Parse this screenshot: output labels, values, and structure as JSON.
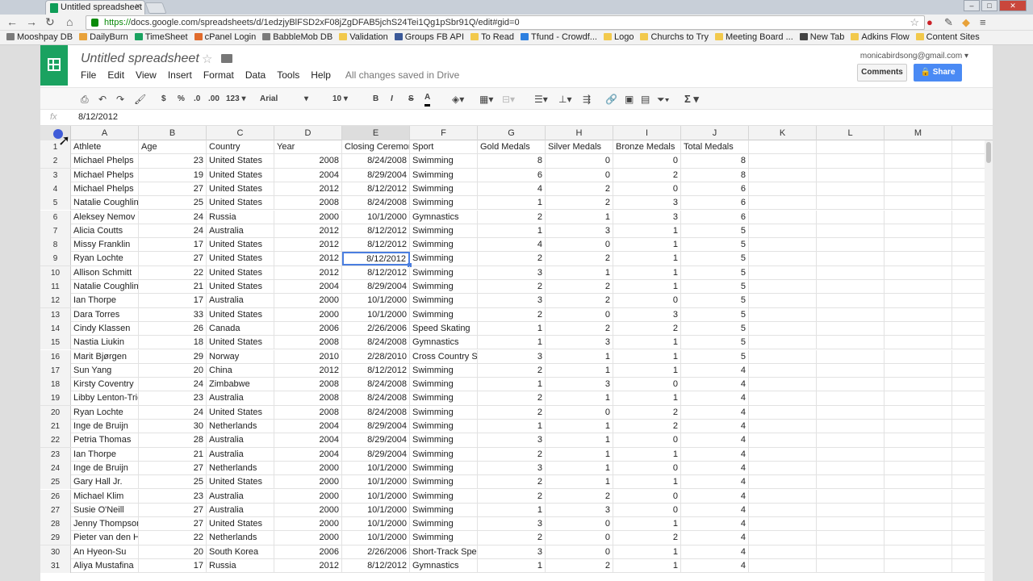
{
  "browser": {
    "tab_title": "Untitled spreadsheet",
    "tab_close": "×",
    "url_scheme": "https://",
    "url_rest": "docs.google.com/spreadsheets/d/1edzjyBlFSD2xF08jZgDFAB5jchS24Tei1Qg1pSbr91Q/edit#gid=0",
    "bookmarks": [
      {
        "label": "Mooshpay DB",
        "color": "#7b7b7b"
      },
      {
        "label": "DailyBurn",
        "color": "#e8a23a"
      },
      {
        "label": "TimeSheet",
        "color": "#1aa260"
      },
      {
        "label": "cPanel Login",
        "color": "#e06b2c"
      },
      {
        "label": "BabbleMob DB",
        "color": "#7b7b7b"
      },
      {
        "label": "Validation",
        "color": "#f2c94c"
      },
      {
        "label": "Groups FB API",
        "color": "#3b5998"
      },
      {
        "label": "To Read",
        "color": "#f2c94c"
      },
      {
        "label": "Tfund - Crowdf...",
        "color": "#2c7fe0"
      },
      {
        "label": "Logo",
        "color": "#f2c94c"
      },
      {
        "label": "Churchs to Try",
        "color": "#f2c94c"
      },
      {
        "label": "Meeting Board ...",
        "color": "#f2c94c"
      },
      {
        "label": "New Tab",
        "color": "#444444"
      },
      {
        "label": "Adkins Flow",
        "color": "#f2c94c"
      },
      {
        "label": "Content Sites",
        "color": "#f2c94c"
      }
    ]
  },
  "sheets": {
    "doc_title": "Untitled spreadsheet",
    "menus": [
      "File",
      "Edit",
      "View",
      "Insert",
      "Format",
      "Data",
      "Tools",
      "Help"
    ],
    "saved_status": "All changes saved in Drive",
    "user_email": "monicabirdsong@gmail.com",
    "comments_label": "Comments",
    "share_label": "Share",
    "toolbar": {
      "currency": "$",
      "percent": "%",
      "dec_decrease": ".0",
      "dec_increase": ".00",
      "more_formats": "123",
      "font": "Arial",
      "font_size": "10",
      "bold": "B",
      "italic": "I",
      "strike": "S",
      "text_color": "A",
      "sum": "Σ"
    },
    "formula_label": "fx",
    "formula_value": "8/12/2012"
  },
  "grid": {
    "columns": [
      "A",
      "B",
      "C",
      "D",
      "E",
      "F",
      "G",
      "H",
      "I",
      "J",
      "K",
      "L",
      "M"
    ],
    "selected_column": "E",
    "selected_row": 9,
    "header_row": [
      "Athlete",
      "Age",
      "Country",
      "Year",
      "Closing Ceremor",
      "Sport",
      "Gold Medals",
      "Silver Medals",
      "Bronze Medals",
      "Total Medals"
    ],
    "rows": [
      [
        "Michael Phelps",
        "23",
        "United States",
        "2008",
        "8/24/2008",
        "Swimming",
        "8",
        "0",
        "0",
        "8"
      ],
      [
        "Michael Phelps",
        "19",
        "United States",
        "2004",
        "8/29/2004",
        "Swimming",
        "6",
        "0",
        "2",
        "8"
      ],
      [
        "Michael Phelps",
        "27",
        "United States",
        "2012",
        "8/12/2012",
        "Swimming",
        "4",
        "2",
        "0",
        "6"
      ],
      [
        "Natalie Coughlin",
        "25",
        "United States",
        "2008",
        "8/24/2008",
        "Swimming",
        "1",
        "2",
        "3",
        "6"
      ],
      [
        "Aleksey Nemov",
        "24",
        "Russia",
        "2000",
        "10/1/2000",
        "Gymnastics",
        "2",
        "1",
        "3",
        "6"
      ],
      [
        "Alicia Coutts",
        "24",
        "Australia",
        "2012",
        "8/12/2012",
        "Swimming",
        "1",
        "3",
        "1",
        "5"
      ],
      [
        "Missy Franklin",
        "17",
        "United States",
        "2012",
        "8/12/2012",
        "Swimming",
        "4",
        "0",
        "1",
        "5"
      ],
      [
        "Ryan Lochte",
        "27",
        "United States",
        "2012",
        "8/12/2012",
        "Swimming",
        "2",
        "2",
        "1",
        "5"
      ],
      [
        "Allison Schmitt",
        "22",
        "United States",
        "2012",
        "8/12/2012",
        "Swimming",
        "3",
        "1",
        "1",
        "5"
      ],
      [
        "Natalie Coughlin",
        "21",
        "United States",
        "2004",
        "8/29/2004",
        "Swimming",
        "2",
        "2",
        "1",
        "5"
      ],
      [
        "Ian Thorpe",
        "17",
        "Australia",
        "2000",
        "10/1/2000",
        "Swimming",
        "3",
        "2",
        "0",
        "5"
      ],
      [
        "Dara Torres",
        "33",
        "United States",
        "2000",
        "10/1/2000",
        "Swimming",
        "2",
        "0",
        "3",
        "5"
      ],
      [
        "Cindy Klassen",
        "26",
        "Canada",
        "2006",
        "2/26/2006",
        "Speed Skating",
        "1",
        "2",
        "2",
        "5"
      ],
      [
        "Nastia Liukin",
        "18",
        "United States",
        "2008",
        "8/24/2008",
        "Gymnastics",
        "1",
        "3",
        "1",
        "5"
      ],
      [
        "Marit Bjørgen",
        "29",
        "Norway",
        "2010",
        "2/28/2010",
        "Cross Country S",
        "3",
        "1",
        "1",
        "5"
      ],
      [
        "Sun Yang",
        "20",
        "China",
        "2012",
        "8/12/2012",
        "Swimming",
        "2",
        "1",
        "1",
        "4"
      ],
      [
        "Kirsty Coventry",
        "24",
        "Zimbabwe",
        "2008",
        "8/24/2008",
        "Swimming",
        "1",
        "3",
        "0",
        "4"
      ],
      [
        "Libby Lenton-Tric",
        "23",
        "Australia",
        "2008",
        "8/24/2008",
        "Swimming",
        "2",
        "1",
        "1",
        "4"
      ],
      [
        "Ryan Lochte",
        "24",
        "United States",
        "2008",
        "8/24/2008",
        "Swimming",
        "2",
        "0",
        "2",
        "4"
      ],
      [
        "Inge de Bruijn",
        "30",
        "Netherlands",
        "2004",
        "8/29/2004",
        "Swimming",
        "1",
        "1",
        "2",
        "4"
      ],
      [
        "Petria Thomas",
        "28",
        "Australia",
        "2004",
        "8/29/2004",
        "Swimming",
        "3",
        "1",
        "0",
        "4"
      ],
      [
        "Ian Thorpe",
        "21",
        "Australia",
        "2004",
        "8/29/2004",
        "Swimming",
        "2",
        "1",
        "1",
        "4"
      ],
      [
        "Inge de Bruijn",
        "27",
        "Netherlands",
        "2000",
        "10/1/2000",
        "Swimming",
        "3",
        "1",
        "0",
        "4"
      ],
      [
        "Gary Hall Jr.",
        "25",
        "United States",
        "2000",
        "10/1/2000",
        "Swimming",
        "2",
        "1",
        "1",
        "4"
      ],
      [
        "Michael Klim",
        "23",
        "Australia",
        "2000",
        "10/1/2000",
        "Swimming",
        "2",
        "2",
        "0",
        "4"
      ],
      [
        "Susie O'Neill",
        "27",
        "Australia",
        "2000",
        "10/1/2000",
        "Swimming",
        "1",
        "3",
        "0",
        "4"
      ],
      [
        "Jenny Thompson",
        "27",
        "United States",
        "2000",
        "10/1/2000",
        "Swimming",
        "3",
        "0",
        "1",
        "4"
      ],
      [
        "Pieter van den H",
        "22",
        "Netherlands",
        "2000",
        "10/1/2000",
        "Swimming",
        "2",
        "0",
        "2",
        "4"
      ],
      [
        "An Hyeon-Su",
        "20",
        "South Korea",
        "2006",
        "2/26/2006",
        "Short-Track Spe",
        "3",
        "0",
        "1",
        "4"
      ],
      [
        "Aliya Mustafina",
        "17",
        "Russia",
        "2012",
        "8/12/2012",
        "Gymnastics",
        "1",
        "2",
        "1",
        "4"
      ]
    ]
  }
}
